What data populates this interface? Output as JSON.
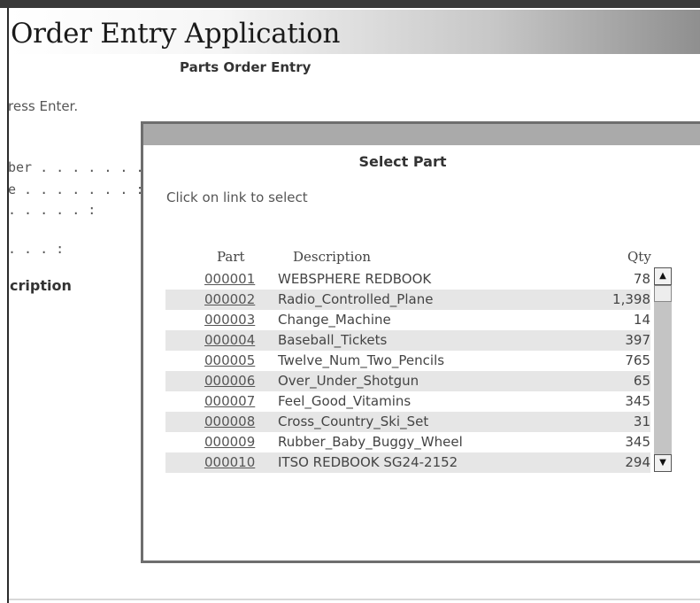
{
  "app": {
    "title": "Order Entry Application",
    "subtitle": "Parts Order Entry"
  },
  "background": {
    "instruction_fragment": "ress Enter.",
    "field1": "ber . . . . . . .",
    "field2": "e . . . . . . . :",
    "field3": ". . . . . :",
    "field4": ". . . :",
    "column_header": "cription"
  },
  "dialog": {
    "title": "Select Part",
    "instruction": "Click on link to select",
    "columns": {
      "part": "Part",
      "description": "Description",
      "qty": "Qty"
    },
    "rows": [
      {
        "part": "000001",
        "description": "WEBSPHERE REDBOOK",
        "qty": "78"
      },
      {
        "part": "000002",
        "description": "Radio_Controlled_Plane",
        "qty": "1,398"
      },
      {
        "part": "000003",
        "description": "Change_Machine",
        "qty": "14"
      },
      {
        "part": "000004",
        "description": "Baseball_Tickets",
        "qty": "397"
      },
      {
        "part": "000005",
        "description": "Twelve_Num_Two_Pencils",
        "qty": "765"
      },
      {
        "part": "000006",
        "description": "Over_Under_Shotgun",
        "qty": "65"
      },
      {
        "part": "000007",
        "description": "Feel_Good_Vitamins",
        "qty": "345"
      },
      {
        "part": "000008",
        "description": "Cross_Country_Ski_Set",
        "qty": "31"
      },
      {
        "part": "000009",
        "description": "Rubber_Baby_Buggy_Wheel",
        "qty": "345"
      },
      {
        "part": "000010",
        "description": "ITSO REDBOOK SG24-2152",
        "qty": "294"
      }
    ],
    "scrollbar": {
      "up_icon": "scroll-up-arrow-icon",
      "down_icon": "scroll-down-arrow-icon",
      "position": 0
    }
  },
  "colors": {
    "title_gradient_end": "#8f8f8f",
    "alt_row": "#e6e6e6",
    "dialog_border": "#6e6e6e",
    "dialog_titlebar": "#aaaaaa"
  }
}
